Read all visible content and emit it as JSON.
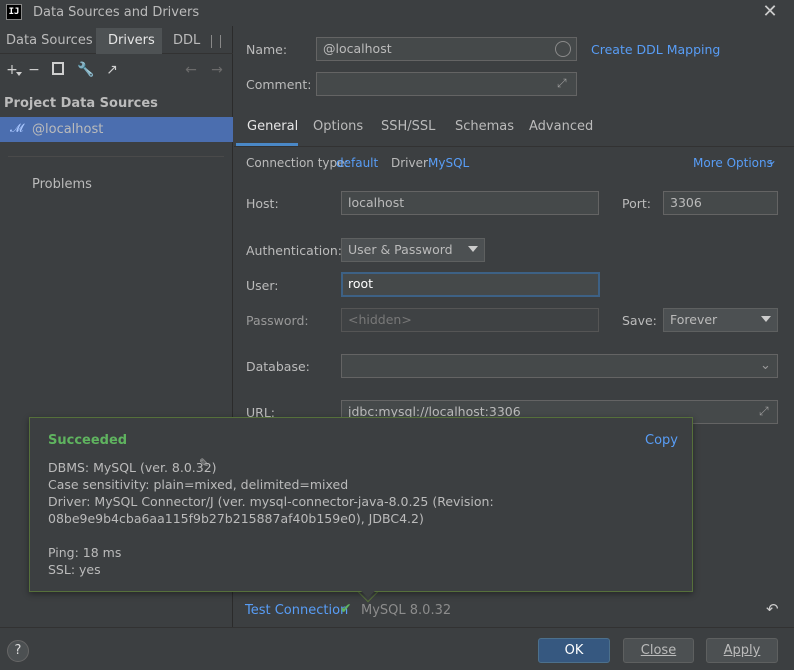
{
  "window": {
    "title": "Data Sources and Drivers"
  },
  "left_panel": {
    "tabs": [
      "Data Sources",
      "Drivers",
      "DDL"
    ],
    "toolbar_icons": [
      "add-icon",
      "remove-icon",
      "duplicate-icon",
      "wrench-icon",
      "jump-icon",
      "back-arrow-icon",
      "forward-arrow-icon"
    ],
    "section_title": "Project Data Sources",
    "selected_item": "@localhost",
    "problems_label": "Problems"
  },
  "form": {
    "name_label": "Name:",
    "name_value": "@localhost",
    "create_ddl_link": "Create DDL Mapping",
    "comment_label": "Comment:",
    "tabs": [
      "General",
      "Options",
      "SSH/SSL",
      "Schemas",
      "Advanced"
    ],
    "connection_type_label": "Connection type:",
    "connection_type_value": "default",
    "driver_label": "Driver:",
    "driver_value": "MySQL",
    "more_options": "More Options",
    "host_label": "Host:",
    "host_value": "localhost",
    "port_label": "Port:",
    "port_value": "3306",
    "auth_label": "Authentication:",
    "auth_value": "User & Password",
    "user_label": "User:",
    "user_value": "root",
    "password_label": "Password:",
    "password_placeholder": "<hidden>",
    "save_label": "Save:",
    "save_value": "Forever",
    "database_label": "Database:",
    "url_label": "URL:",
    "url_value": "jdbc:mysql://localhost:3306"
  },
  "popup": {
    "status": "Succeeded",
    "copy": "Copy",
    "lines": [
      "DBMS: MySQL (ver. 8.0.32)",
      "Case sensitivity: plain=mixed, delimited=mixed",
      "Driver: MySQL Connector/J (ver. mysql-connector-java-8.0.25 (Revision:",
      "08be9e9b4cba6aa115f9b27b215887af40b159e0), JDBC4.2)",
      "Ping: 18 ms",
      "SSL: yes"
    ]
  },
  "bottom": {
    "test_connection": "Test Connection",
    "test_result": "MySQL 8.0.32"
  },
  "footer": {
    "help": "?",
    "ok": "OK",
    "close": "Close",
    "apply": "Apply"
  }
}
